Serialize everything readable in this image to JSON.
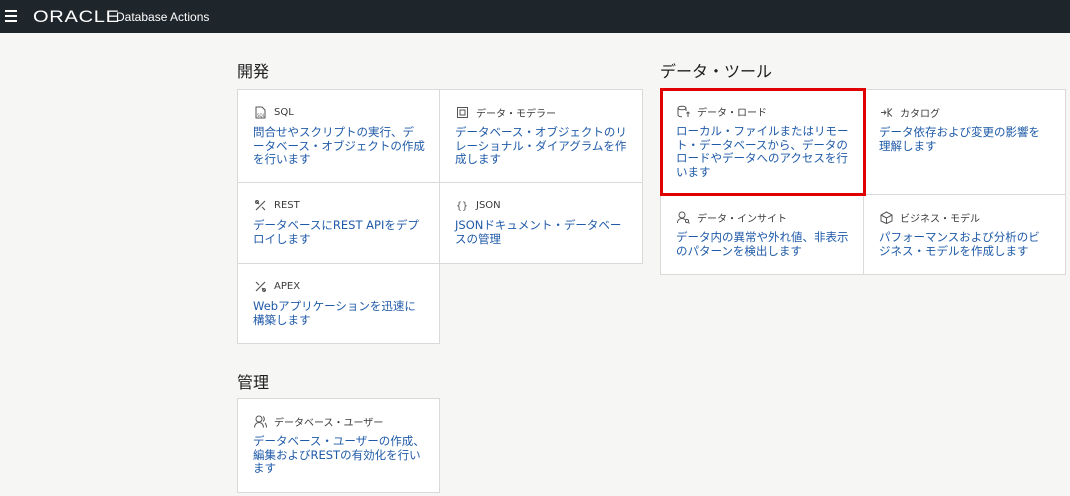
{
  "header": {
    "logo": "ORACLE",
    "app_title": "Database Actions"
  },
  "sections": {
    "development": {
      "title": "開発",
      "cards": {
        "sql": {
          "title": "SQL",
          "desc": "問合せやスクリプトの実行、データベース・オブジェクトの作成を行います",
          "icon": "sql-icon"
        },
        "data_modeler": {
          "title": "データ・モデラー",
          "desc": "データベース・オブジェクトのリレーショナル・ダイアグラムを作成します",
          "icon": "modeler-icon"
        },
        "rest": {
          "title": "REST",
          "desc": "データベースにREST APIをデプロイします",
          "icon": "rest-icon"
        },
        "json": {
          "title": "JSON",
          "desc": "JSONドキュメント・データベースの管理",
          "icon": "json-icon"
        },
        "apex": {
          "title": "APEX",
          "desc": "Webアプリケーションを迅速に構築します",
          "icon": "apex-icon"
        }
      }
    },
    "data_tools": {
      "title": "データ・ツール",
      "cards": {
        "data_load": {
          "title": "データ・ロード",
          "desc": "ローカル・ファイルまたはリモート・データベースから、データのロードやデータへのアクセスを行います",
          "icon": "data-load-icon"
        },
        "catalog": {
          "title": "カタログ",
          "desc": "データ依存および変更の影響を理解します",
          "icon": "catalog-icon"
        },
        "data_insight": {
          "title": "データ・インサイト",
          "desc": "データ内の異常や外れ値、非表示のパターンを検出します",
          "icon": "data-insight-icon"
        },
        "business_model": {
          "title": "ビジネス・モデル",
          "desc": "パフォーマンスおよび分析のビジネス・モデルを作成します",
          "icon": "business-model-icon"
        }
      }
    },
    "admin": {
      "title": "管理",
      "cards": {
        "db_users": {
          "title": "データベース・ユーザー",
          "desc": "データベース・ユーザーの作成、編集およびRESTの有効化を行います",
          "icon": "users-icon"
        }
      }
    }
  },
  "colors": {
    "topbar": "#1e252b",
    "link": "#1f5aa8",
    "highlight": "#e00000"
  }
}
